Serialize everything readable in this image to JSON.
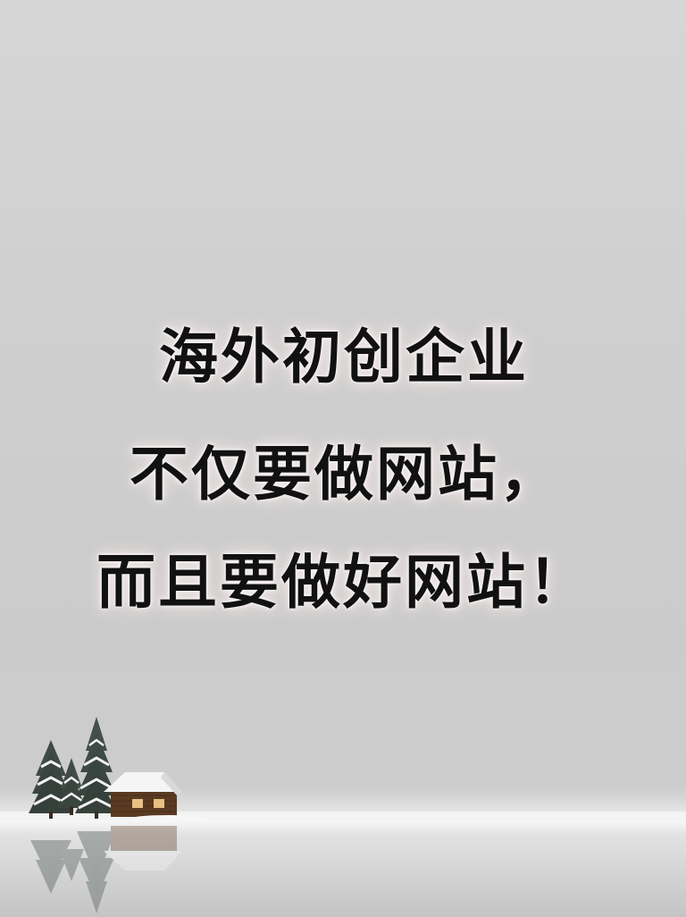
{
  "headline": {
    "line1": "海外初创企业",
    "line2": "不仅要做网站，",
    "line3": "而且要做好网站！"
  },
  "colors": {
    "background": "#cfcfcf",
    "text": "#111111",
    "glow": "#f2eaea",
    "snow": "#f4f4f4",
    "cabin": "#5a3a22"
  },
  "scene": {
    "elements": [
      "snowy-pine-trees",
      "wooden-cabin",
      "lake-reflection"
    ]
  }
}
